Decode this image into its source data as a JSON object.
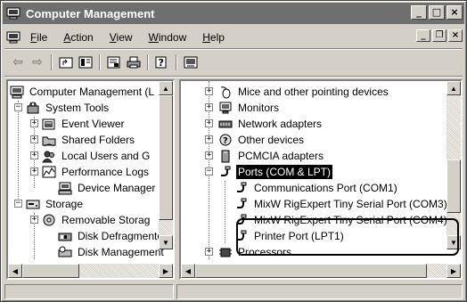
{
  "window": {
    "title": "Computer Management"
  },
  "menu": {
    "items": [
      {
        "label": "File",
        "key": "F",
        "rest": "ile"
      },
      {
        "label": "Action",
        "key": "A",
        "rest": "ction"
      },
      {
        "label": "View",
        "key": "V",
        "rest": "iew"
      },
      {
        "label": "Window",
        "key": "W",
        "rest": "indow"
      },
      {
        "label": "Help",
        "key": "H",
        "rest": "elp"
      }
    ]
  },
  "toolbar": {
    "icons": [
      "back-arrow-icon",
      "forward-arrow-icon",
      "up-level-icon",
      "show-hide-tree-icon",
      "properties-icon",
      "print-icon",
      "help-icon",
      "device-manager-icon"
    ]
  },
  "left_tree": {
    "items": [
      {
        "label": "Computer Management (L",
        "icon": "computer-icon"
      },
      {
        "label": "System Tools",
        "icon": "tools-icon"
      },
      {
        "label": "Event Viewer",
        "icon": "event-viewer-icon"
      },
      {
        "label": "Shared Folders",
        "icon": "shared-folders-icon"
      },
      {
        "label": "Local Users and G",
        "icon": "users-icon"
      },
      {
        "label": "Performance Logs",
        "icon": "performance-icon"
      },
      {
        "label": "Device Manager",
        "icon": "device-manager-icon"
      },
      {
        "label": "Storage",
        "icon": "storage-icon"
      },
      {
        "label": "Removable Storag",
        "icon": "removable-storage-icon"
      },
      {
        "label": "Disk Defragmente",
        "icon": "defrag-icon"
      },
      {
        "label": "Disk Management",
        "icon": "disk-management-icon"
      }
    ]
  },
  "right_tree": {
    "items": [
      {
        "label": "Mice and other pointing devices",
        "icon": "mouse-icon"
      },
      {
        "label": "Monitors",
        "icon": "monitor-icon"
      },
      {
        "label": "Network adapters",
        "icon": "network-icon"
      },
      {
        "label": "Other devices",
        "icon": "unknown-device-icon"
      },
      {
        "label": "PCMCIA adapters",
        "icon": "pcmcia-icon"
      },
      {
        "label": "Ports (COM & LPT)",
        "icon": "port-icon"
      },
      {
        "label": "Communications Port (COM1)",
        "icon": "port-icon"
      },
      {
        "label": "MixW RigExpert Tiny Serial Port (COM3)",
        "icon": "port-icon"
      },
      {
        "label": "MixW RigExpert Tiny Serial Port (COM4)",
        "icon": "port-icon"
      },
      {
        "label": "Printer Port (LPT1)",
        "icon": "port-icon"
      },
      {
        "label": "Processors",
        "icon": "processor-icon"
      }
    ]
  },
  "colors": {
    "selection": "#000000",
    "titlebar": "#6f6f6f",
    "chrome": "#d4d0c8"
  }
}
